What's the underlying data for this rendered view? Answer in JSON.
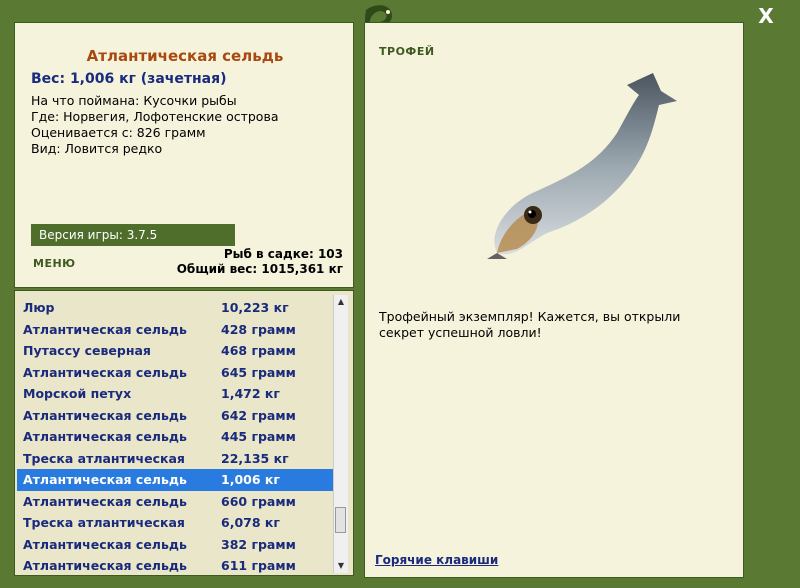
{
  "window": {
    "close_label": "X"
  },
  "catch": {
    "title": "Атлантическая сельдь",
    "weight_line": "Вес: 1,006 кг (зачетная)",
    "bait": "На что поймана: Кусочки рыбы",
    "location": "Где: Норвегия, Лофотенские острова",
    "rated_from": "Оценивается с: 826 грамм",
    "species": "Вид: Ловится редко"
  },
  "version_label": "Версия игры: 3.7.5",
  "menu_label": "МЕНЮ",
  "stats": {
    "fish_in_cage": "Рыб в садке: 103",
    "total_weight": "Общий вес: 1015,361 кг"
  },
  "list": [
    {
      "name": "Люр",
      "weight": "10,223 кг"
    },
    {
      "name": "Атлантическая сельдь",
      "weight": "428 грамм"
    },
    {
      "name": "Путассу северная",
      "weight": "468 грамм"
    },
    {
      "name": "Атлантическая сельдь",
      "weight": "645 грамм"
    },
    {
      "name": "Морской петух",
      "weight": "1,472 кг"
    },
    {
      "name": "Атлантическая сельдь",
      "weight": "642 грамм"
    },
    {
      "name": "Атлантическая сельдь",
      "weight": "445 грамм"
    },
    {
      "name": "Треска атлантическая",
      "weight": "22,135 кг"
    },
    {
      "name": "Атлантическая сельдь",
      "weight": "1,006 кг"
    },
    {
      "name": "Атлантическая сельдь",
      "weight": "660 грамм"
    },
    {
      "name": "Треска атлантическая",
      "weight": "6,078 кг"
    },
    {
      "name": "Атлантическая сельдь",
      "weight": "382 грамм"
    },
    {
      "name": "Атлантическая сельдь",
      "weight": "611 грамм"
    }
  ],
  "selected_index": 8,
  "trophy": {
    "label": "ТРОФЕЙ",
    "text": "Трофейный экземпляр! Кажется, вы открыли секрет успешной ловли!"
  },
  "hotkeys_label": "Горячие клавиши",
  "colors": {
    "frame": "#5a7a34",
    "panel": "#f6f3dd",
    "title": "#a84a10",
    "accent": "#1a2a7c",
    "selection": "#2a7be0"
  }
}
